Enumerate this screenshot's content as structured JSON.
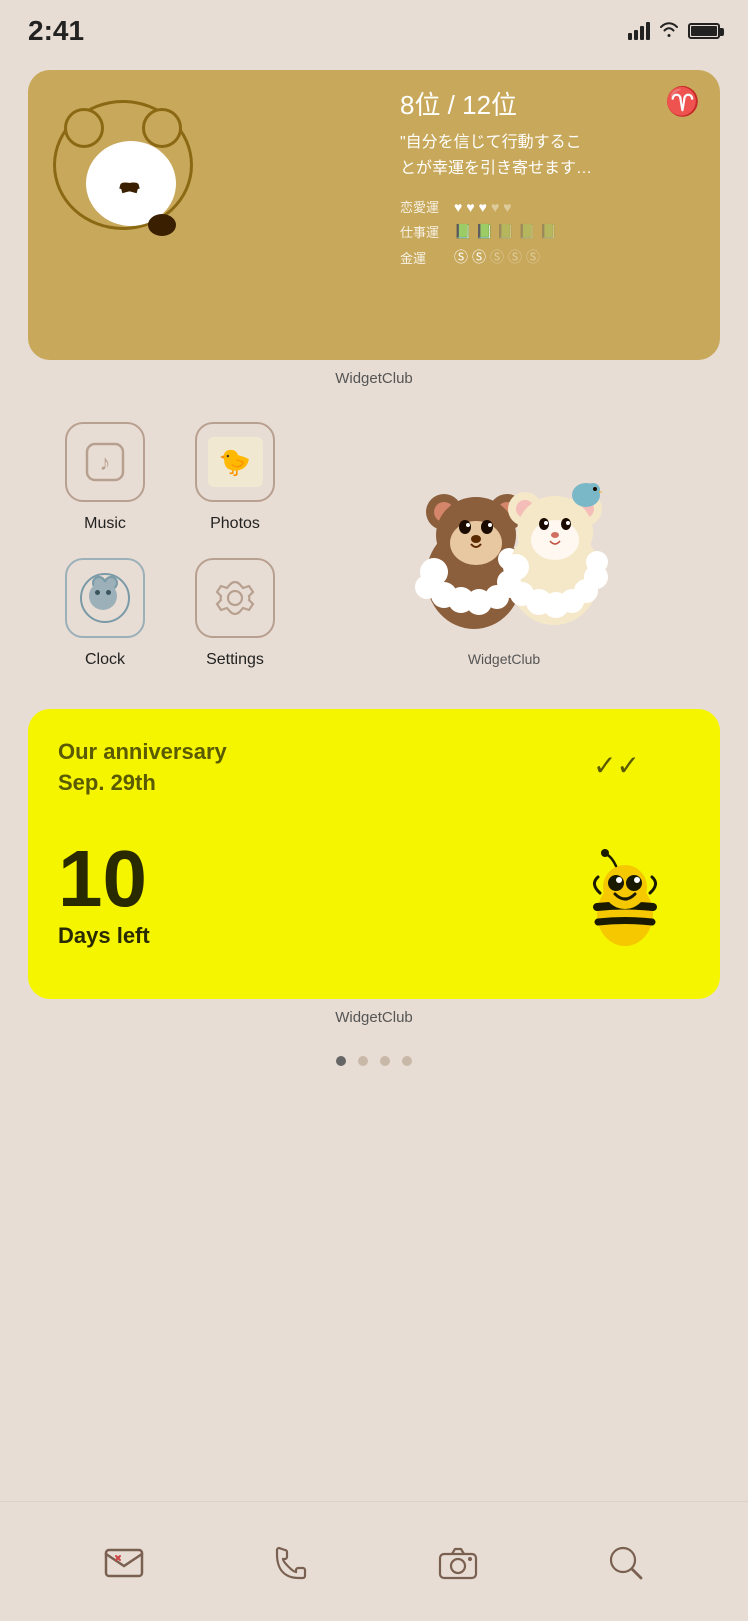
{
  "statusBar": {
    "time": "2:41",
    "signalBars": 4,
    "batteryFull": true
  },
  "fortuneWidget": {
    "rank": "8位 / 12位",
    "zodiac": "♈",
    "quote": "\"自分を信じて行動するこ\nとが幸運を引き寄せます…",
    "rows": [
      {
        "label": "恋愛運",
        "filled": 3,
        "empty": 2,
        "icon": "♥"
      },
      {
        "label": "仕事運",
        "filled": 2,
        "empty": 3,
        "icon": "📖"
      },
      {
        "label": "金運",
        "filled": 2,
        "empty": 3,
        "icon": "Ⓢ"
      }
    ],
    "widgetLabel": "WidgetClub"
  },
  "apps": [
    {
      "id": "music",
      "label": "Music",
      "icon": "music"
    },
    {
      "id": "photos",
      "label": "Photos",
      "icon": "photos"
    },
    {
      "id": "clock",
      "label": "Clock",
      "icon": "clock"
    },
    {
      "id": "settings",
      "label": "Settings",
      "icon": "settings"
    }
  ],
  "rilakkumaLabel": "WidgetClub",
  "anniversaryWidget": {
    "title": "Our anniversary\nSep. 29th",
    "count": "10",
    "daysLeft": "Days left",
    "widgetLabel": "WidgetClub"
  },
  "pageDots": [
    {
      "active": true
    },
    {
      "active": false
    },
    {
      "active": false
    },
    {
      "active": false
    }
  ],
  "dock": {
    "items": [
      {
        "id": "mail",
        "label": "Mail"
      },
      {
        "id": "phone",
        "label": "Phone"
      },
      {
        "id": "camera",
        "label": "Camera"
      },
      {
        "id": "search",
        "label": "Search"
      }
    ]
  }
}
